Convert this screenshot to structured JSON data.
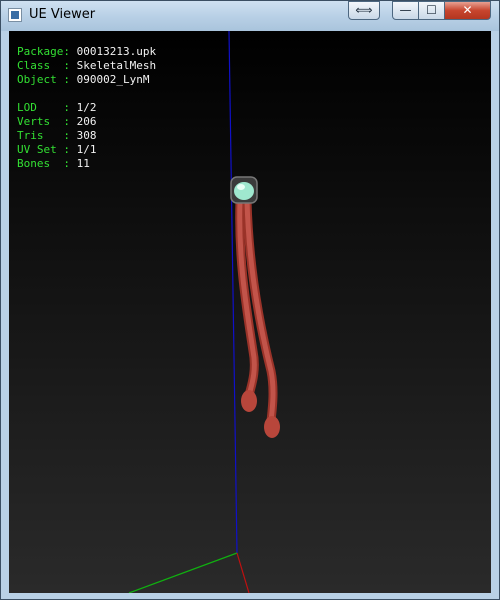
{
  "window": {
    "title": "UE Viewer",
    "controls": {
      "restore_extra": "⟺",
      "minimize": "—",
      "maximize": "☐",
      "close": "✕"
    }
  },
  "info": {
    "package_label": "Package: ",
    "package_value": "00013213.upk",
    "class_label": "Class  : ",
    "class_value": "SkeletalMesh",
    "object_label": "Object : ",
    "object_value": "090002_LynM",
    "lod_label": "LOD    : ",
    "lod_value": "1/2",
    "verts_label": "Verts  : ",
    "verts_value": "206",
    "tris_label": "Tris   : ",
    "tris_value": "308",
    "uvset_label": "UV Set : ",
    "uvset_value": "1/1",
    "bones_label": "Bones  : ",
    "bones_value": "11"
  },
  "colors": {
    "label_green": "#33e033",
    "value_white": "#f2f2f2",
    "axis_blue": "#1010c8",
    "axis_green": "#10b010",
    "axis_red": "#c01010",
    "mesh_red": "#b8463b",
    "mesh_cap": "#9fe8cf"
  }
}
